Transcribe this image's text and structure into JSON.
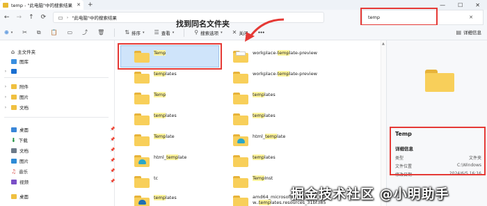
{
  "window": {
    "tab_title": "temp - \"此电脑\"中的搜索结果",
    "tab_close": "✕",
    "new_tab": "+",
    "controls": [
      "—",
      "☐",
      "✕"
    ]
  },
  "address": {
    "path": "\"此电脑\"中的搜索结果",
    "search_value": "temp",
    "search_clear": "✕"
  },
  "toolbar": {
    "new_label": "",
    "sort_label": "排序",
    "view_label": "查看",
    "search_options_label": "搜索选项",
    "close_label": "关闭",
    "more_label": "•••",
    "details_label": "详细信息"
  },
  "annotation": {
    "text": "找到同名文件夹",
    "color": "#e53935"
  },
  "sidebar": {
    "items": [
      {
        "label": "主文件夹",
        "icon": "home-icon"
      },
      {
        "label": "图库",
        "icon": "gallery-icon"
      },
      {
        "label": "",
        "icon": "cloud-icon"
      },
      {
        "label": "附件",
        "icon": "folder-icon"
      },
      {
        "label": "图片",
        "icon": "folder-icon"
      },
      {
        "label": "文档",
        "icon": "folder-icon"
      },
      {
        "label": "桌面",
        "icon": "desktop-icon"
      },
      {
        "label": "下载",
        "icon": "download-icon"
      },
      {
        "label": "文档",
        "icon": "documents-icon"
      },
      {
        "label": "图片",
        "icon": "pictures-icon"
      },
      {
        "label": "音乐",
        "icon": "music-icon"
      },
      {
        "label": "视频",
        "icon": "video-icon"
      },
      {
        "label": "桌面",
        "icon": "folder-icon"
      }
    ]
  },
  "results": {
    "left": [
      {
        "name": "Temp",
        "hl": "Temp",
        "pre": "",
        "post": "",
        "selected": true
      },
      {
        "name": "templates",
        "pre": "",
        "hl": "temp",
        "post": "lates"
      },
      {
        "name": "Temp",
        "pre": "",
        "hl": "Temp",
        "post": ""
      },
      {
        "name": "templates",
        "pre": "",
        "hl": "temp",
        "post": "lates"
      },
      {
        "name": "Template",
        "pre": "",
        "hl": "Temp",
        "post": "late"
      },
      {
        "name": "html_template",
        "pre": "html_",
        "hl": "temp",
        "post": "late"
      },
      {
        "name": "tc",
        "pre": "tc",
        "hl": "",
        "post": ""
      },
      {
        "name": "templates",
        "pre": "",
        "hl": "temp",
        "post": "lates"
      }
    ],
    "right": [
      {
        "name": "workplace-template-preview",
        "pre": "workplace-",
        "hl": "temp",
        "post": "late-preview"
      },
      {
        "name": "workplace-template-preview",
        "pre": "workplace-",
        "hl": "temp",
        "post": "late-preview"
      },
      {
        "name": "templates",
        "pre": "",
        "hl": "temp",
        "post": "lates"
      },
      {
        "name": "templates",
        "pre": "",
        "hl": "temp",
        "post": "lates"
      },
      {
        "name": "html_template",
        "pre": "html_",
        "hl": "temp",
        "post": "late"
      },
      {
        "name": "templates",
        "pre": "",
        "hl": "temp",
        "post": "lates"
      },
      {
        "name": "TempInst",
        "pre": "",
        "hl": "Temp",
        "post": "Inst"
      },
      {
        "name": "amd64_microsoft-windows-",
        "pre": "amd64_microsoft-windows-",
        "hl": "",
        "post": ""
      }
    ],
    "right_extra": {
      "pre": "w..",
      "hl": "temp",
      "post": "lates.resources_31bf385"
    }
  },
  "details": {
    "name": "Temp",
    "section": "详细信息",
    "rows": [
      {
        "k": "类型",
        "v": "文件夹"
      },
      {
        "k": "文件位置",
        "v": "C:\\Windows"
      },
      {
        "k": "修改日期",
        "v": "2024/6/5 16:16"
      }
    ]
  },
  "watermark": "掘金技术社区 @小明助手"
}
